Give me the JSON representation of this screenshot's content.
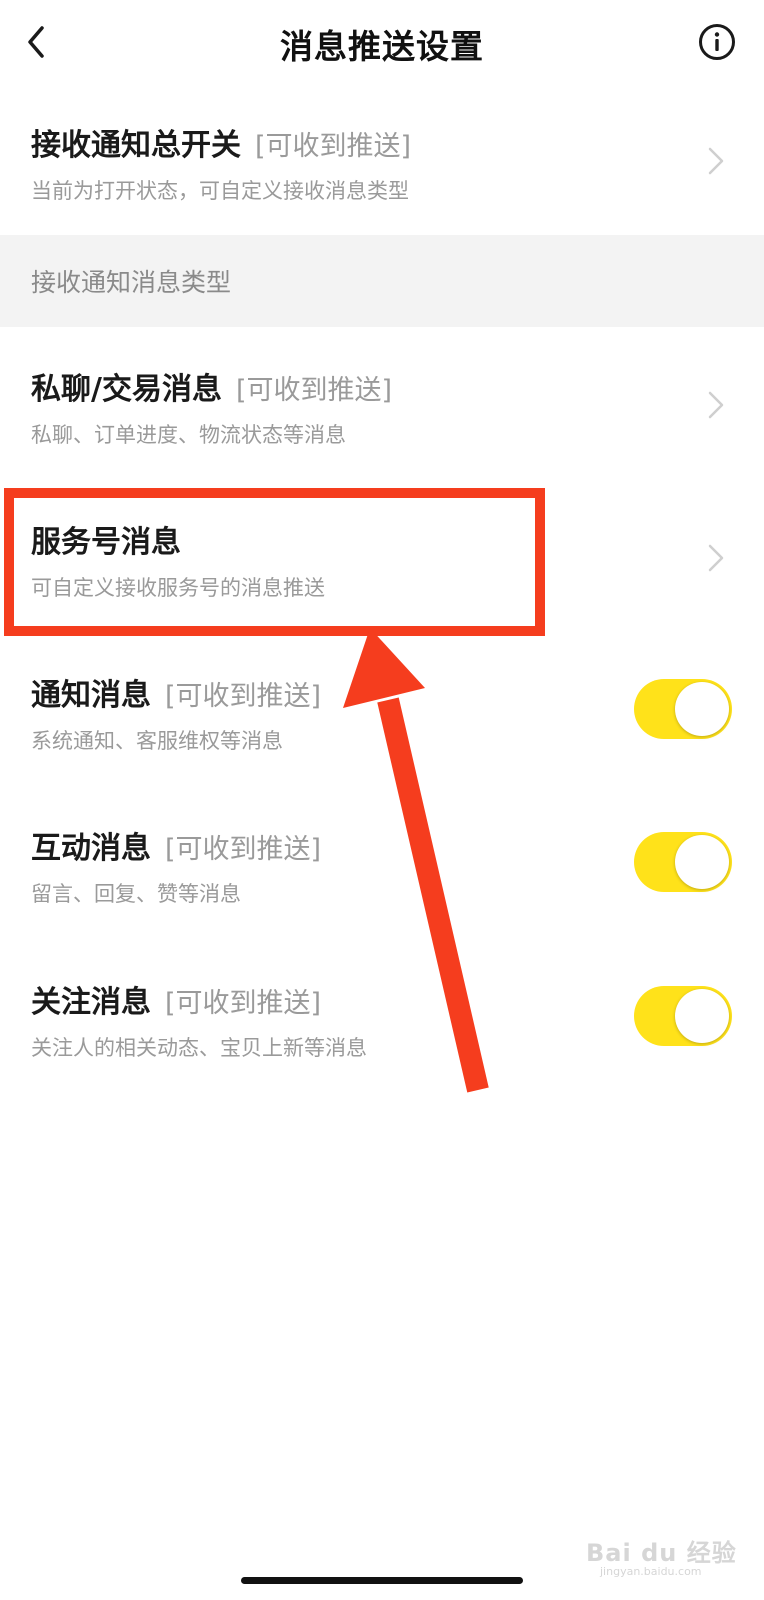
{
  "header": {
    "title": "消息推送设置",
    "back_icon": "chevron-left-icon",
    "info_icon": "info-circle-icon"
  },
  "master_switch": {
    "title": "接收通知总开关",
    "status": "[可收到推送]",
    "subtitle": "当前为打开状态，可自定义接收消息类型"
  },
  "section": {
    "label": "接收通知消息类型"
  },
  "rows": [
    {
      "title": "私聊/交易消息",
      "status": "[可收到推送]",
      "subtitle": "私聊、订单进度、物流状态等消息",
      "control": "chevron"
    },
    {
      "title": "服务号消息",
      "status": "",
      "subtitle": "可自定义接收服务号的消息推送",
      "control": "chevron"
    },
    {
      "title": "通知消息",
      "status": "[可收到推送]",
      "subtitle": "系统通知、客服维权等消息",
      "control": "toggle",
      "on": true
    },
    {
      "title": "互动消息",
      "status": "[可收到推送]",
      "subtitle": "留言、回复、赞等消息",
      "control": "toggle",
      "on": true
    },
    {
      "title": "关注消息",
      "status": "[可收到推送]",
      "subtitle": "关注人的相关动态、宝贝上新等消息",
      "control": "toggle",
      "on": true
    }
  ],
  "watermark": {
    "brand": "Bai du 经验",
    "url": "jingyan.baidu.com"
  },
  "colors": {
    "toggle_on": "#ffe21a",
    "annotation_red": "#f53d1e",
    "section_bg": "#f3f3f3"
  }
}
